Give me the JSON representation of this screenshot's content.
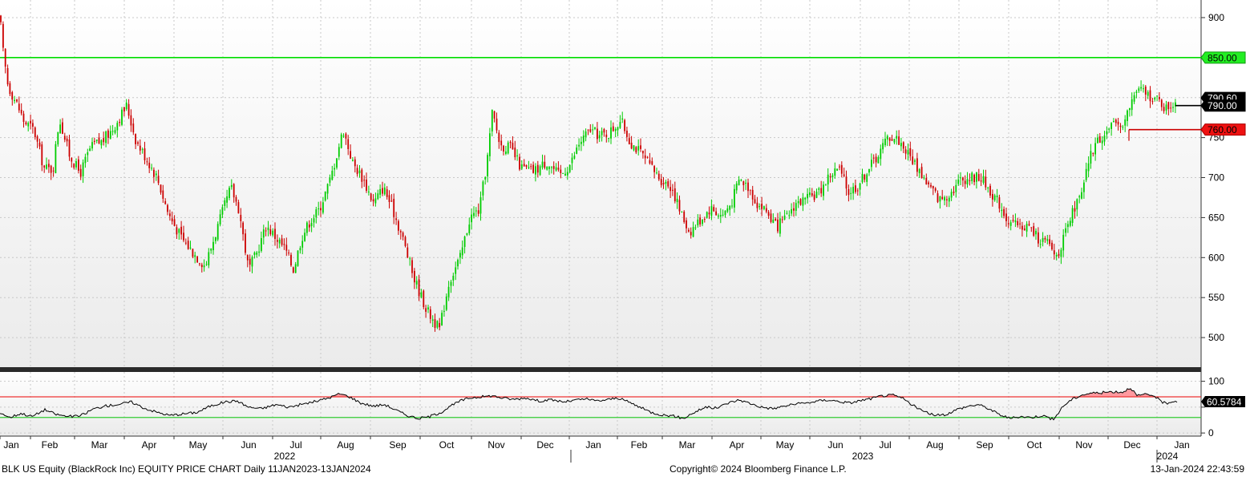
{
  "chart_data": {
    "type": "candlestick",
    "x_tick_labels": [
      "Jan",
      "Feb",
      "Mar",
      "Apr",
      "May",
      "Jun",
      "Jul",
      "Aug",
      "Sep",
      "Oct",
      "Nov",
      "Dec",
      "Jan",
      "Feb",
      "Mar",
      "Apr",
      "May",
      "Jun",
      "Jul",
      "Aug",
      "Sep",
      "Oct",
      "Nov",
      "Dec",
      "Jan"
    ],
    "year_labels": [
      "2022",
      "2023",
      "2024"
    ],
    "price_axis": {
      "ticks": [
        900,
        850,
        800,
        750,
        700,
        650,
        600,
        550,
        500
      ],
      "tick_labels": [
        "900",
        "",
        "",
        "750",
        "700",
        "650",
        "600",
        "550",
        "500"
      ],
      "ylim": [
        463,
        922
      ]
    },
    "price_series": {
      "anchors": [
        [
          0,
          900
        ],
        [
          4,
          855
        ],
        [
          10,
          815
        ],
        [
          22,
          790
        ],
        [
          30,
          770
        ],
        [
          42,
          760
        ],
        [
          55,
          712
        ],
        [
          66,
          710
        ],
        [
          74,
          775
        ],
        [
          86,
          730
        ],
        [
          100,
          705
        ],
        [
          112,
          735
        ],
        [
          118,
          742
        ],
        [
          127,
          745
        ],
        [
          140,
          760
        ],
        [
          158,
          790
        ],
        [
          170,
          745
        ],
        [
          185,
          720
        ],
        [
          196,
          700
        ],
        [
          210,
          655
        ],
        [
          226,
          625
        ],
        [
          242,
          605
        ],
        [
          256,
          590
        ],
        [
          272,
          640
        ],
        [
          288,
          688
        ],
        [
          298,
          660
        ],
        [
          310,
          585
        ],
        [
          320,
          605
        ],
        [
          332,
          640
        ],
        [
          342,
          628
        ],
        [
          356,
          610
        ],
        [
          366,
          585
        ],
        [
          376,
          625
        ],
        [
          386,
          645
        ],
        [
          398,
          660
        ],
        [
          412,
          698
        ],
        [
          428,
          760
        ],
        [
          440,
          718
        ],
        [
          452,
          700
        ],
        [
          466,
          668
        ],
        [
          478,
          688
        ],
        [
          490,
          660
        ],
        [
          502,
          625
        ],
        [
          516,
          575
        ],
        [
          532,
          535
        ],
        [
          548,
          510
        ],
        [
          560,
          570
        ],
        [
          574,
          600
        ],
        [
          586,
          650
        ],
        [
          598,
          660
        ],
        [
          608,
          725
        ],
        [
          614,
          782
        ],
        [
          624,
          740
        ],
        [
          636,
          738
        ],
        [
          650,
          712
        ],
        [
          666,
          708
        ],
        [
          682,
          720
        ],
        [
          698,
          702
        ],
        [
          712,
          718
        ],
        [
          722,
          742
        ],
        [
          736,
          760
        ],
        [
          748,
          752
        ],
        [
          760,
          756
        ],
        [
          774,
          772
        ],
        [
          786,
          745
        ],
        [
          798,
          732
        ],
        [
          810,
          715
        ],
        [
          824,
          698
        ],
        [
          838,
          688
        ],
        [
          848,
          658
        ],
        [
          860,
          632
        ],
        [
          874,
          648
        ],
        [
          886,
          662
        ],
        [
          900,
          652
        ],
        [
          912,
          668
        ],
        [
          922,
          698
        ],
        [
          934,
          688
        ],
        [
          944,
          668
        ],
        [
          956,
          658
        ],
        [
          968,
          638
        ],
        [
          980,
          648
        ],
        [
          992,
          668
        ],
        [
          1006,
          672
        ],
        [
          1022,
          682
        ],
        [
          1034,
          702
        ],
        [
          1046,
          712
        ],
        [
          1058,
          682
        ],
        [
          1070,
          690
        ],
        [
          1082,
          710
        ],
        [
          1096,
          730
        ],
        [
          1108,
          752
        ],
        [
          1120,
          748
        ],
        [
          1134,
          728
        ],
        [
          1146,
          710
        ],
        [
          1158,
          690
        ],
        [
          1172,
          672
        ],
        [
          1186,
          682
        ],
        [
          1198,
          698
        ],
        [
          1210,
          700
        ],
        [
          1222,
          702
        ],
        [
          1234,
          685
        ],
        [
          1246,
          668
        ],
        [
          1258,
          645
        ],
        [
          1270,
          638
        ],
        [
          1282,
          640
        ],
        [
          1294,
          625
        ],
        [
          1306,
          618
        ],
        [
          1318,
          602
        ],
        [
          1330,
          632
        ],
        [
          1340,
          662
        ],
        [
          1350,
          680
        ],
        [
          1358,
          722
        ],
        [
          1366,
          742
        ],
        [
          1378,
          756
        ],
        [
          1390,
          765
        ],
        [
          1402,
          770
        ],
        [
          1410,
          790
        ],
        [
          1416,
          808
        ],
        [
          1426,
          808
        ],
        [
          1438,
          800
        ],
        [
          1446,
          795
        ],
        [
          1454,
          786
        ],
        [
          1462,
          792
        ],
        [
          1468,
          797
        ]
      ],
      "last_price": 790.6,
      "high_marker": 790.0,
      "low_marker": 760.0,
      "resistance": 850.0
    },
    "price_tags": [
      "850.00",
      "790.00",
      "760.00",
      "790.60"
    ],
    "rsi_axis": {
      "ticks": [
        100,
        50,
        0
      ],
      "tick_labels": [
        "100",
        "",
        "0"
      ],
      "ylim": [
        -6,
        118
      ]
    },
    "rsi_levels": {
      "upper": 70,
      "lower": 30
    },
    "rsi_last_label": "60.5784",
    "rsi_series": {
      "anchors": [
        [
          0,
          40
        ],
        [
          12,
          30
        ],
        [
          26,
          38
        ],
        [
          40,
          32
        ],
        [
          56,
          45
        ],
        [
          70,
          36
        ],
        [
          84,
          32
        ],
        [
          100,
          33
        ],
        [
          116,
          46
        ],
        [
          130,
          52
        ],
        [
          150,
          56
        ],
        [
          164,
          60
        ],
        [
          180,
          48
        ],
        [
          196,
          40
        ],
        [
          212,
          34
        ],
        [
          228,
          37
        ],
        [
          246,
          40
        ],
        [
          262,
          52
        ],
        [
          280,
          60
        ],
        [
          296,
          62
        ],
        [
          310,
          50
        ],
        [
          326,
          47
        ],
        [
          344,
          55
        ],
        [
          360,
          50
        ],
        [
          378,
          56
        ],
        [
          396,
          62
        ],
        [
          410,
          68
        ],
        [
          424,
          76
        ],
        [
          436,
          70
        ],
        [
          450,
          58
        ],
        [
          466,
          52
        ],
        [
          480,
          55
        ],
        [
          494,
          44
        ],
        [
          508,
          34
        ],
        [
          522,
          28
        ],
        [
          536,
          32
        ],
        [
          550,
          40
        ],
        [
          562,
          52
        ],
        [
          574,
          62
        ],
        [
          586,
          68
        ],
        [
          600,
          70
        ],
        [
          614,
          72
        ],
        [
          626,
          68
        ],
        [
          640,
          65
        ],
        [
          656,
          68
        ],
        [
          672,
          62
        ],
        [
          688,
          64
        ],
        [
          704,
          60
        ],
        [
          716,
          63
        ],
        [
          730,
          66
        ],
        [
          744,
          62
        ],
        [
          756,
          64
        ],
        [
          770,
          68
        ],
        [
          784,
          60
        ],
        [
          798,
          50
        ],
        [
          812,
          40
        ],
        [
          826,
          35
        ],
        [
          840,
          33
        ],
        [
          852,
          28
        ],
        [
          866,
          40
        ],
        [
          880,
          50
        ],
        [
          894,
          48
        ],
        [
          908,
          58
        ],
        [
          922,
          64
        ],
        [
          936,
          57
        ],
        [
          950,
          50
        ],
        [
          964,
          47
        ],
        [
          978,
          52
        ],
        [
          992,
          56
        ],
        [
          1006,
          58
        ],
        [
          1020,
          62
        ],
        [
          1034,
          64
        ],
        [
          1046,
          61
        ],
        [
          1060,
          58
        ],
        [
          1074,
          63
        ],
        [
          1088,
          67
        ],
        [
          1100,
          72
        ],
        [
          1114,
          73
        ],
        [
          1126,
          67
        ],
        [
          1140,
          52
        ],
        [
          1154,
          40
        ],
        [
          1168,
          34
        ],
        [
          1180,
          36
        ],
        [
          1194,
          46
        ],
        [
          1208,
          52
        ],
        [
          1220,
          55
        ],
        [
          1232,
          48
        ],
        [
          1246,
          36
        ],
        [
          1260,
          28
        ],
        [
          1272,
          32
        ],
        [
          1286,
          30
        ],
        [
          1300,
          34
        ],
        [
          1314,
          26
        ],
        [
          1326,
          52
        ],
        [
          1336,
          64
        ],
        [
          1348,
          73
        ],
        [
          1360,
          77
        ],
        [
          1374,
          78
        ],
        [
          1388,
          80
        ],
        [
          1400,
          79
        ],
        [
          1410,
          88
        ],
        [
          1418,
          72
        ],
        [
          1428,
          74
        ],
        [
          1440,
          72
        ],
        [
          1448,
          60
        ],
        [
          1456,
          58
        ],
        [
          1464,
          62
        ],
        [
          1468,
          61
        ]
      ],
      "overbought_fill": "#ff9aa0"
    },
    "colors": {
      "up": "#00cc00",
      "down": "#cc0000",
      "resistance_line": "#00dd00",
      "rsi_upper_line": "#ee3333",
      "rsi_lower_line": "#33cc33",
      "rsi_line": "#000000",
      "tag_dark": "#000000",
      "panel_top": "#ffffff",
      "panel_bottom": "#ececec"
    }
  },
  "footer": {
    "left": "BLK US Equity (BlackRock Inc) EQUITY PRICE CHART  Daily 11JAN2023-13JAN2024",
    "center": "Copyright© 2024 Bloomberg Finance L.P.",
    "right": "13-Jan-2024 22:43:59"
  }
}
